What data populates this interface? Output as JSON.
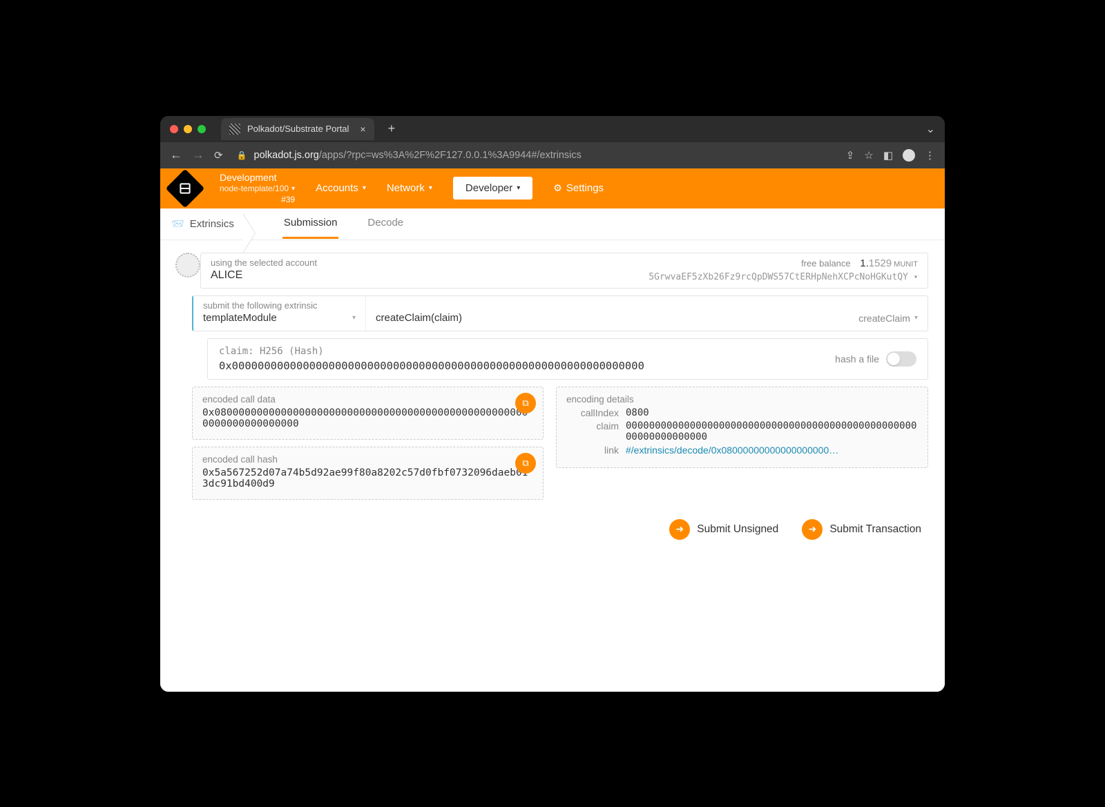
{
  "browser": {
    "tab_title": "Polkadot/Substrate Portal",
    "url_host": "polkadot.js.org",
    "url_path": "/apps/?rpc=ws%3A%2F%2F127.0.0.1%3A9944#/extrinsics"
  },
  "header": {
    "chain_env": "Development",
    "chain_info": "node-template/100",
    "chain_block": "#39",
    "menu_accounts": "Accounts",
    "menu_network": "Network",
    "menu_developer": "Developer",
    "menu_settings": "Settings"
  },
  "subnav": {
    "section": "Extrinsics",
    "tab_submission": "Submission",
    "tab_decode": "Decode"
  },
  "account": {
    "label": "using the selected account",
    "name": "ALICE",
    "balance_label": "free balance",
    "balance_int": "1.",
    "balance_frac": "1529",
    "balance_unit": "MUNIT",
    "address": "5GrwvaEF5zXb26Fz9rcQpDWS57CtERHpNehXCPcNoHGKutQY"
  },
  "extrinsic": {
    "section_label": "submit the following extrinsic",
    "module": "templateModule",
    "method": "createClaim(claim)",
    "method_short": "createClaim"
  },
  "claim": {
    "label": "claim: H256 (Hash)",
    "value": "0x0000000000000000000000000000000000000000000000000000000000000000",
    "hash_file_label": "hash a file"
  },
  "encoded": {
    "call_data_label": "encoded call data",
    "call_data": "0x08000000000000000000000000000000000000000000000000000000000000000000",
    "call_hash_label": "encoded call hash",
    "call_hash": "0x5a567252d07a74b5d92ae99f80a8202c57d0fbf0732096daeb013dc91bd400d9",
    "details_label": "encoding details",
    "detail_callIndex_k": "callIndex",
    "detail_callIndex_v": "0800",
    "detail_claim_k": "claim",
    "detail_claim_v": "0000000000000000000000000000000000000000000000000000000000000000",
    "detail_link_k": "link",
    "detail_link_v": "#/extrinsics/decode/0x08000000000000000000…"
  },
  "actions": {
    "submit_unsigned": "Submit Unsigned",
    "submit_tx": "Submit Transaction"
  }
}
